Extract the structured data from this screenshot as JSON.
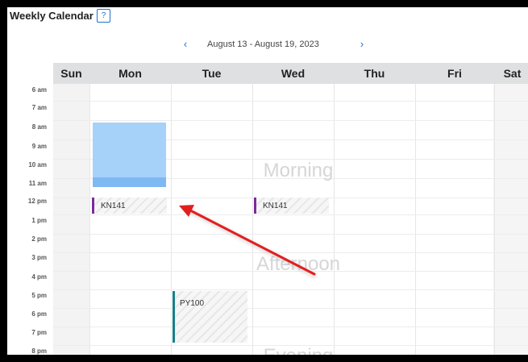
{
  "header": {
    "title": "Weekly Calendar",
    "help_icon": "help-circle-icon",
    "help_glyph": "?"
  },
  "nav": {
    "prev_glyph": "‹",
    "next_glyph": "›",
    "range": "August 13 - August 19, 2023"
  },
  "days": [
    "Sun",
    "Mon",
    "Tue",
    "Wed",
    "Thu",
    "Fri",
    "Sat"
  ],
  "hours": [
    "6 am",
    "7 am",
    "8 am",
    "9 am",
    "10 am",
    "11 am",
    "12 pm",
    "1 pm",
    "2 pm",
    "3 pm",
    "4 pm",
    "5 pm",
    "6 pm",
    "7 pm",
    "8 pm"
  ],
  "periods": {
    "morning": "Morning",
    "afternoon": "Afternoon",
    "evening": "Evening"
  },
  "events": [
    {
      "label": "KN141",
      "day": "Mon",
      "time": "12 pm"
    },
    {
      "label": "KN141",
      "day": "Wed",
      "time": "12 pm"
    },
    {
      "label": "PY100",
      "day": "Tue",
      "time": "5 pm"
    }
  ],
  "colors": {
    "accent": "#1e73c9",
    "header_bg": "#dfe0e2",
    "selection": "#a6d1f9",
    "event_purple": "#7b2a9a",
    "event_teal": "#16808a",
    "annotation_arrow": "#e31e1e"
  }
}
